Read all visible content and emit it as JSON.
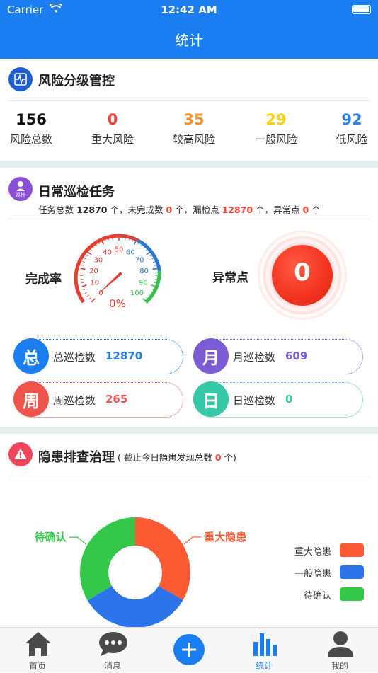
{
  "status_bar": {
    "carrier": "Carrier",
    "time": "12:42 AM"
  },
  "nav": {
    "title": "统计"
  },
  "risk": {
    "title": "风险分级管控",
    "stats": [
      {
        "value": "156",
        "label": "风险总数",
        "color": "#111111"
      },
      {
        "value": "0",
        "label": "重大风险",
        "color": "#f0443a"
      },
      {
        "value": "35",
        "label": "较高风险",
        "color": "#f7932e"
      },
      {
        "value": "29",
        "label": "一般风险",
        "color": "#f2d21b"
      },
      {
        "value": "92",
        "label": "低风险",
        "color": "#2f86e8"
      }
    ]
  },
  "patrol": {
    "title": "日常巡检任务",
    "icon_text": "巡检",
    "summary": {
      "t1": "任务总数 ",
      "total": "12870",
      "t2": " 个，未完成数 ",
      "unfinished": "0",
      "t3": " 个，漏检点 ",
      "missed": "12870",
      "t4": " 个，异常点 ",
      "abnormal": "0",
      "t5": " 个"
    },
    "completion_label": "完成率",
    "gauge_value": "0%",
    "gauge_ticks": [
      "0",
      "10",
      "20",
      "30",
      "40",
      "50",
      "60",
      "70",
      "80",
      "90",
      "100"
    ],
    "abnormal_label": "异常点",
    "abnormal_value": "0",
    "cards": [
      {
        "badge": "总",
        "label": "总巡检数",
        "value": "12870",
        "color": "#1a7ef2"
      },
      {
        "badge": "月",
        "label": "月巡检数",
        "value": "609",
        "color": "#7b5bd6"
      },
      {
        "badge": "周",
        "label": "周巡检数",
        "value": "265",
        "color": "#f0534a"
      },
      {
        "badge": "日",
        "label": "日巡检数",
        "value": "0",
        "color": "#36c9a8"
      }
    ]
  },
  "hazard": {
    "title": "隐患排查治理",
    "note_prefix": "( 截止今日隐患发现总数 ",
    "note_count": "0",
    "note_suffix": " 个)",
    "chart_data": {
      "type": "pie",
      "categories": [
        "重大隐患",
        "一般隐患",
        "待确认"
      ],
      "values": [
        33.3,
        33.3,
        33.4
      ],
      "colors": [
        "#fb5a32",
        "#2d74ea",
        "#34c84a"
      ],
      "legend_position": "right",
      "callouts": [
        "重大隐患",
        "待确认"
      ]
    }
  },
  "tabbar": {
    "items": [
      {
        "label": "首页",
        "icon": "home-icon"
      },
      {
        "label": "消息",
        "icon": "message-icon"
      },
      {
        "label": "",
        "icon": "plus-icon"
      },
      {
        "label": "统计",
        "icon": "bar-chart-icon",
        "active": true
      },
      {
        "label": "我的",
        "icon": "user-icon"
      }
    ],
    "active_color": "#1a7ef2"
  }
}
